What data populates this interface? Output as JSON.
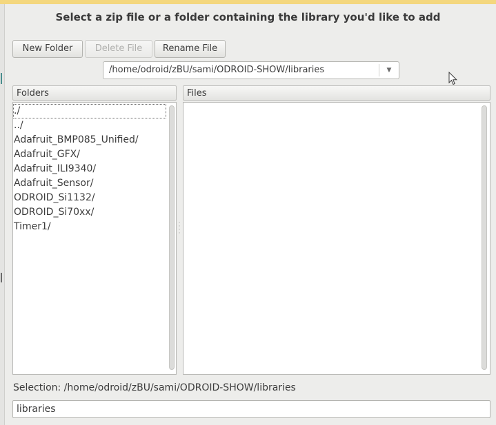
{
  "dialog": {
    "title": "Select a zip file or a folder containing the library you'd like to add"
  },
  "toolbar": {
    "new_folder_label": "New Folder",
    "delete_file_label": "Delete File",
    "rename_file_label": "Rename File"
  },
  "path_combo": {
    "value": "/home/odroid/zBU/sami/ODROID-SHOW/libraries",
    "arrow_icon": "chevron-down-icon"
  },
  "folders": {
    "header": "Folders",
    "items": [
      "./",
      "../",
      "Adafruit_BMP085_Unified/",
      "Adafruit_GFX/",
      "Adafruit_ILI9340/",
      "Adafruit_Sensor/",
      "ODROID_Si1132/",
      "ODROID_Si70xx/",
      "Timer1/"
    ]
  },
  "files": {
    "header": "Files",
    "items": []
  },
  "selection": {
    "label": "Selection: /home/odroid/zBU/sami/ODROID-SHOW/libraries",
    "value": "libraries"
  },
  "colors": {
    "top_strip": "#f4d77e",
    "dialog_background": "#ededeb"
  }
}
